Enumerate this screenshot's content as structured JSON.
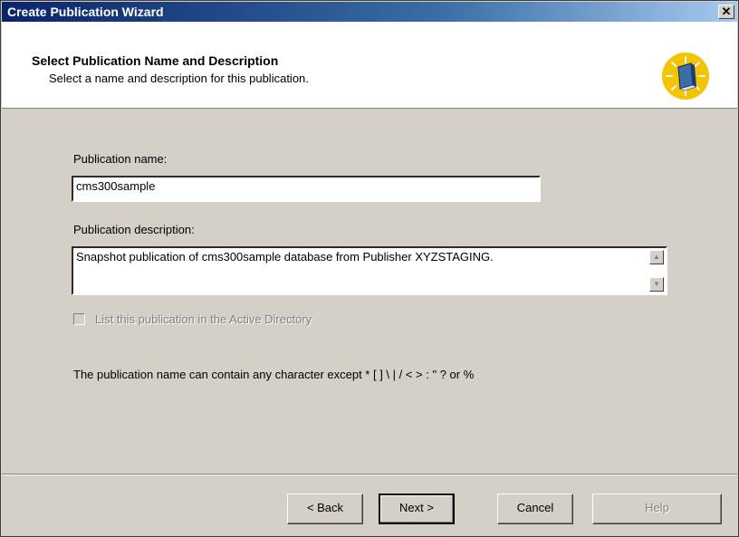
{
  "window": {
    "title": "Create Publication Wizard",
    "close_glyph": "✕"
  },
  "header": {
    "title": "Select Publication Name and Description",
    "subtitle": "Select a name and description for this publication.",
    "icon": "publication-book-icon"
  },
  "form": {
    "name_label": "Publication name:",
    "name_value": "cms300sample",
    "description_label": "Publication description:",
    "description_value": "Snapshot publication of cms300sample database from Publisher XYZSTAGING.",
    "active_directory_label": "List this publication in the Active Directory",
    "active_directory_checked": false,
    "note": "The publication name can contain any character except * [ ] \\ | / < > : \" ? or %"
  },
  "buttons": {
    "back": "< Back",
    "next": "Next >",
    "cancel": "Cancel",
    "help": "Help"
  },
  "colors": {
    "titlebar_start": "#0a246a",
    "titlebar_end": "#a6caf0",
    "dialog_bg": "#d4d0c8",
    "icon_sun": "#f5c400",
    "icon_book": "#3a6ea5"
  }
}
